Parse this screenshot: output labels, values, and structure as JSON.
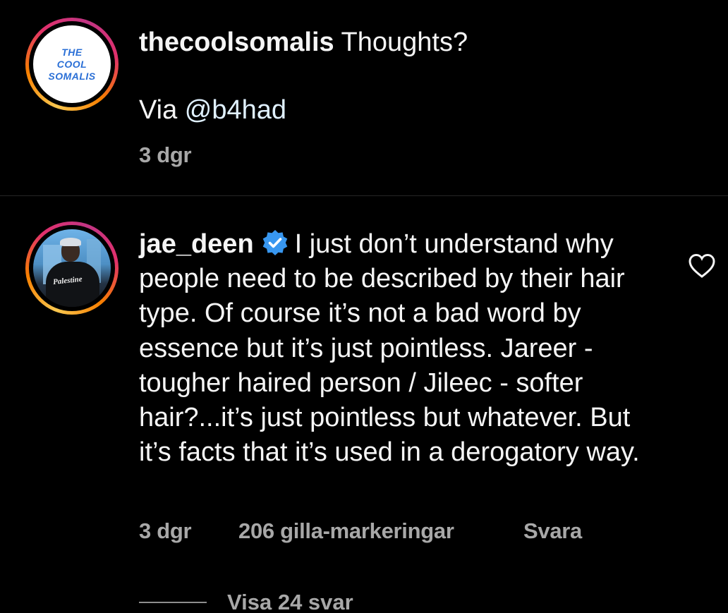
{
  "post": {
    "username": "thecoolsomalis",
    "caption": "Thoughts?",
    "via_prefix": "Via ",
    "mention": "@b4had",
    "time": "3 dgr",
    "avatar_logo_text": [
      "THE",
      "COOL",
      "SOMALIS"
    ]
  },
  "comment": {
    "username": "jae_deen",
    "verified": true,
    "text": "I just don’t understand why people need to be described by their hair type. Of course it’s not a bad word by essence but it’s just pointless. Jareer - tougher haired person / Jileec - softer hair?...it’s just pointless but whatever. But it’s facts that it’s used in a derogatory way.",
    "time": "3 dgr",
    "likes": "206 gilla-markeringar",
    "reply_label": "Svara",
    "view_replies": "Visa 24 svar",
    "avatar_shirt_text": "Palestine"
  },
  "colors": {
    "background": "#000000",
    "primary_text": "#f5f5f5",
    "secondary_text": "#a8a8a8",
    "verified_blue": "#3897f0"
  },
  "icons": {
    "verified": "verified-badge-icon",
    "like": "heart-outline-icon"
  }
}
